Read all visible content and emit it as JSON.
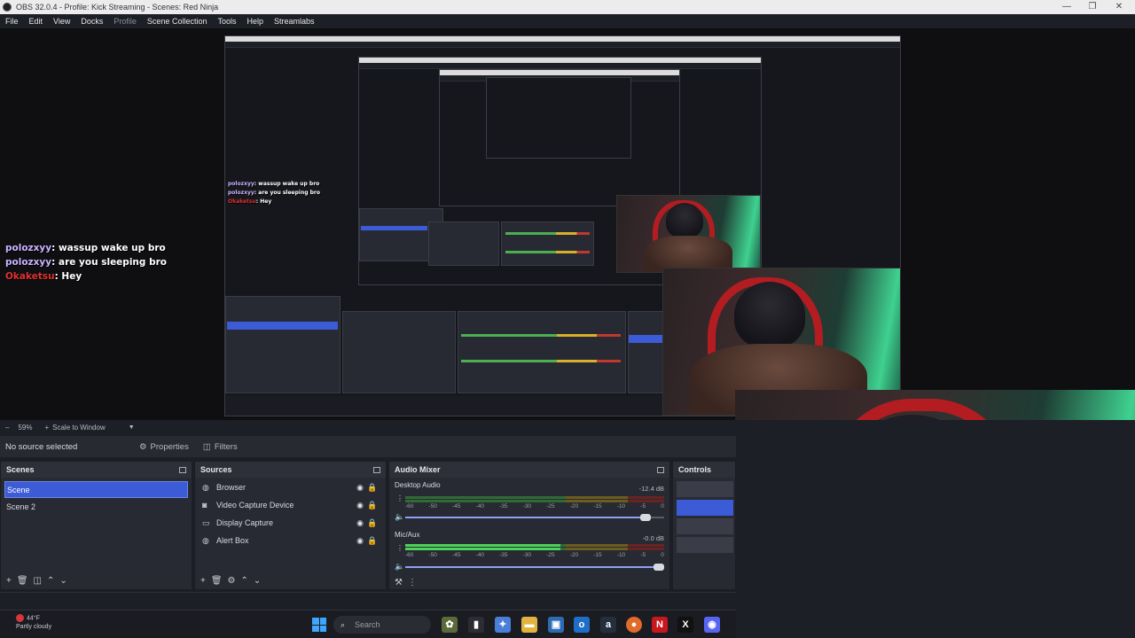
{
  "window": {
    "title": "OBS 32.0.4 - Profile: Kick Streaming - Scenes: Red Ninja",
    "controls": [
      "—",
      "❐",
      "✕"
    ]
  },
  "menu": [
    "File",
    "Edit",
    "View",
    "Docks",
    "Profile",
    "Scene Collection",
    "Tools",
    "Help",
    "Streamlabs"
  ],
  "chat": [
    {
      "user": "polozxyy",
      "message": "wassup wake up bro",
      "color": "#c9b4ff"
    },
    {
      "user": "polozxyy",
      "message": "are you sleeping bro",
      "color": "#c9b4ff"
    },
    {
      "user": "Okaketsu",
      "message": "Hey",
      "color": "#e03131"
    }
  ],
  "preview_toolbar": {
    "zoom": "59%",
    "scale_mode": "Scale to Window"
  },
  "source_toolbar": {
    "no_source": "No source selected",
    "properties": "Properties",
    "filters": "Filters"
  },
  "scenes": {
    "title": "Scenes",
    "items": [
      "Scene",
      "Scene 2"
    ],
    "selected": 0
  },
  "sources": {
    "title": "Sources",
    "items": [
      {
        "name": "Browser",
        "icon": "globe-icon",
        "glyph": "◍"
      },
      {
        "name": "Video Capture Device",
        "icon": "camera-icon",
        "glyph": "◙"
      },
      {
        "name": "Display Capture",
        "icon": "monitor-icon",
        "glyph": "▭"
      },
      {
        "name": "Alert Box",
        "icon": "globe-icon",
        "glyph": "◍"
      }
    ]
  },
  "audio_mixer": {
    "title": "Audio Mixer",
    "tracks": [
      {
        "name": "Desktop Audio",
        "db": "-12.4 dB",
        "level": 0.0,
        "volume": 0.95
      },
      {
        "name": "Mic/Aux",
        "db": "-0.0 dB",
        "level": 0.6,
        "volume": 1.0
      }
    ],
    "scale": [
      "-60",
      "-50",
      "-45",
      "-40",
      "-35",
      "-30",
      "-25",
      "-20",
      "-15",
      "-10",
      "-5",
      "0"
    ]
  },
  "controls": {
    "title": "Controls"
  },
  "taskbar": {
    "weather_temp": "44°F",
    "weather_desc": "Partly cloudy",
    "search_placeholder": "Search"
  }
}
